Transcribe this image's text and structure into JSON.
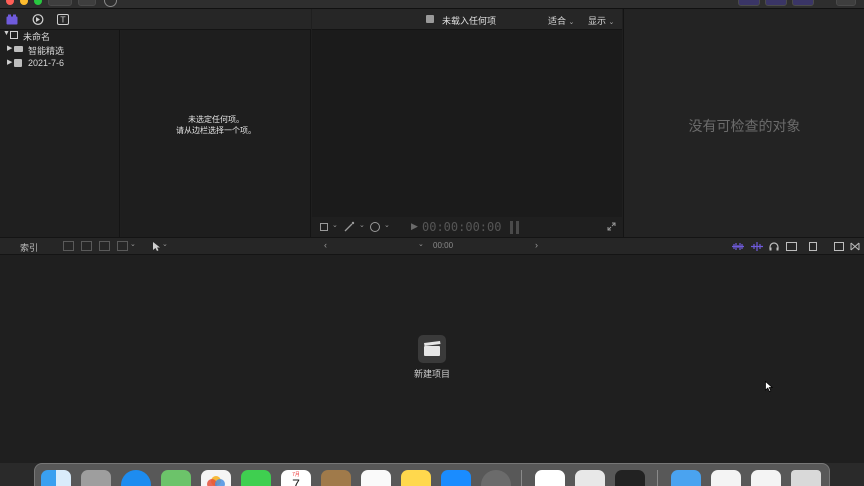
{
  "viewer": {
    "title": "未载入任何项",
    "fit_menu": "适合",
    "display_menu": "显示",
    "timecode": "00:00:00:00"
  },
  "sidebar": {
    "library": "未命名",
    "items": [
      {
        "label": "智能精选"
      },
      {
        "label": "2021-7-6"
      }
    ]
  },
  "browser": {
    "empty_line1": "未选定任何项。",
    "empty_line2": "请从边栏选择一个项。"
  },
  "inspector": {
    "empty": "没有可检查的对象"
  },
  "timeline": {
    "index_button": "索引",
    "timecode": "00:00",
    "new_project": "新建项目"
  },
  "dock": {
    "calendar_month": "7月",
    "calendar_day": "7"
  },
  "colors": {
    "accent_purple": "#6f5bdc",
    "panel": "#1f1f1f",
    "toolbar": "#262626"
  }
}
